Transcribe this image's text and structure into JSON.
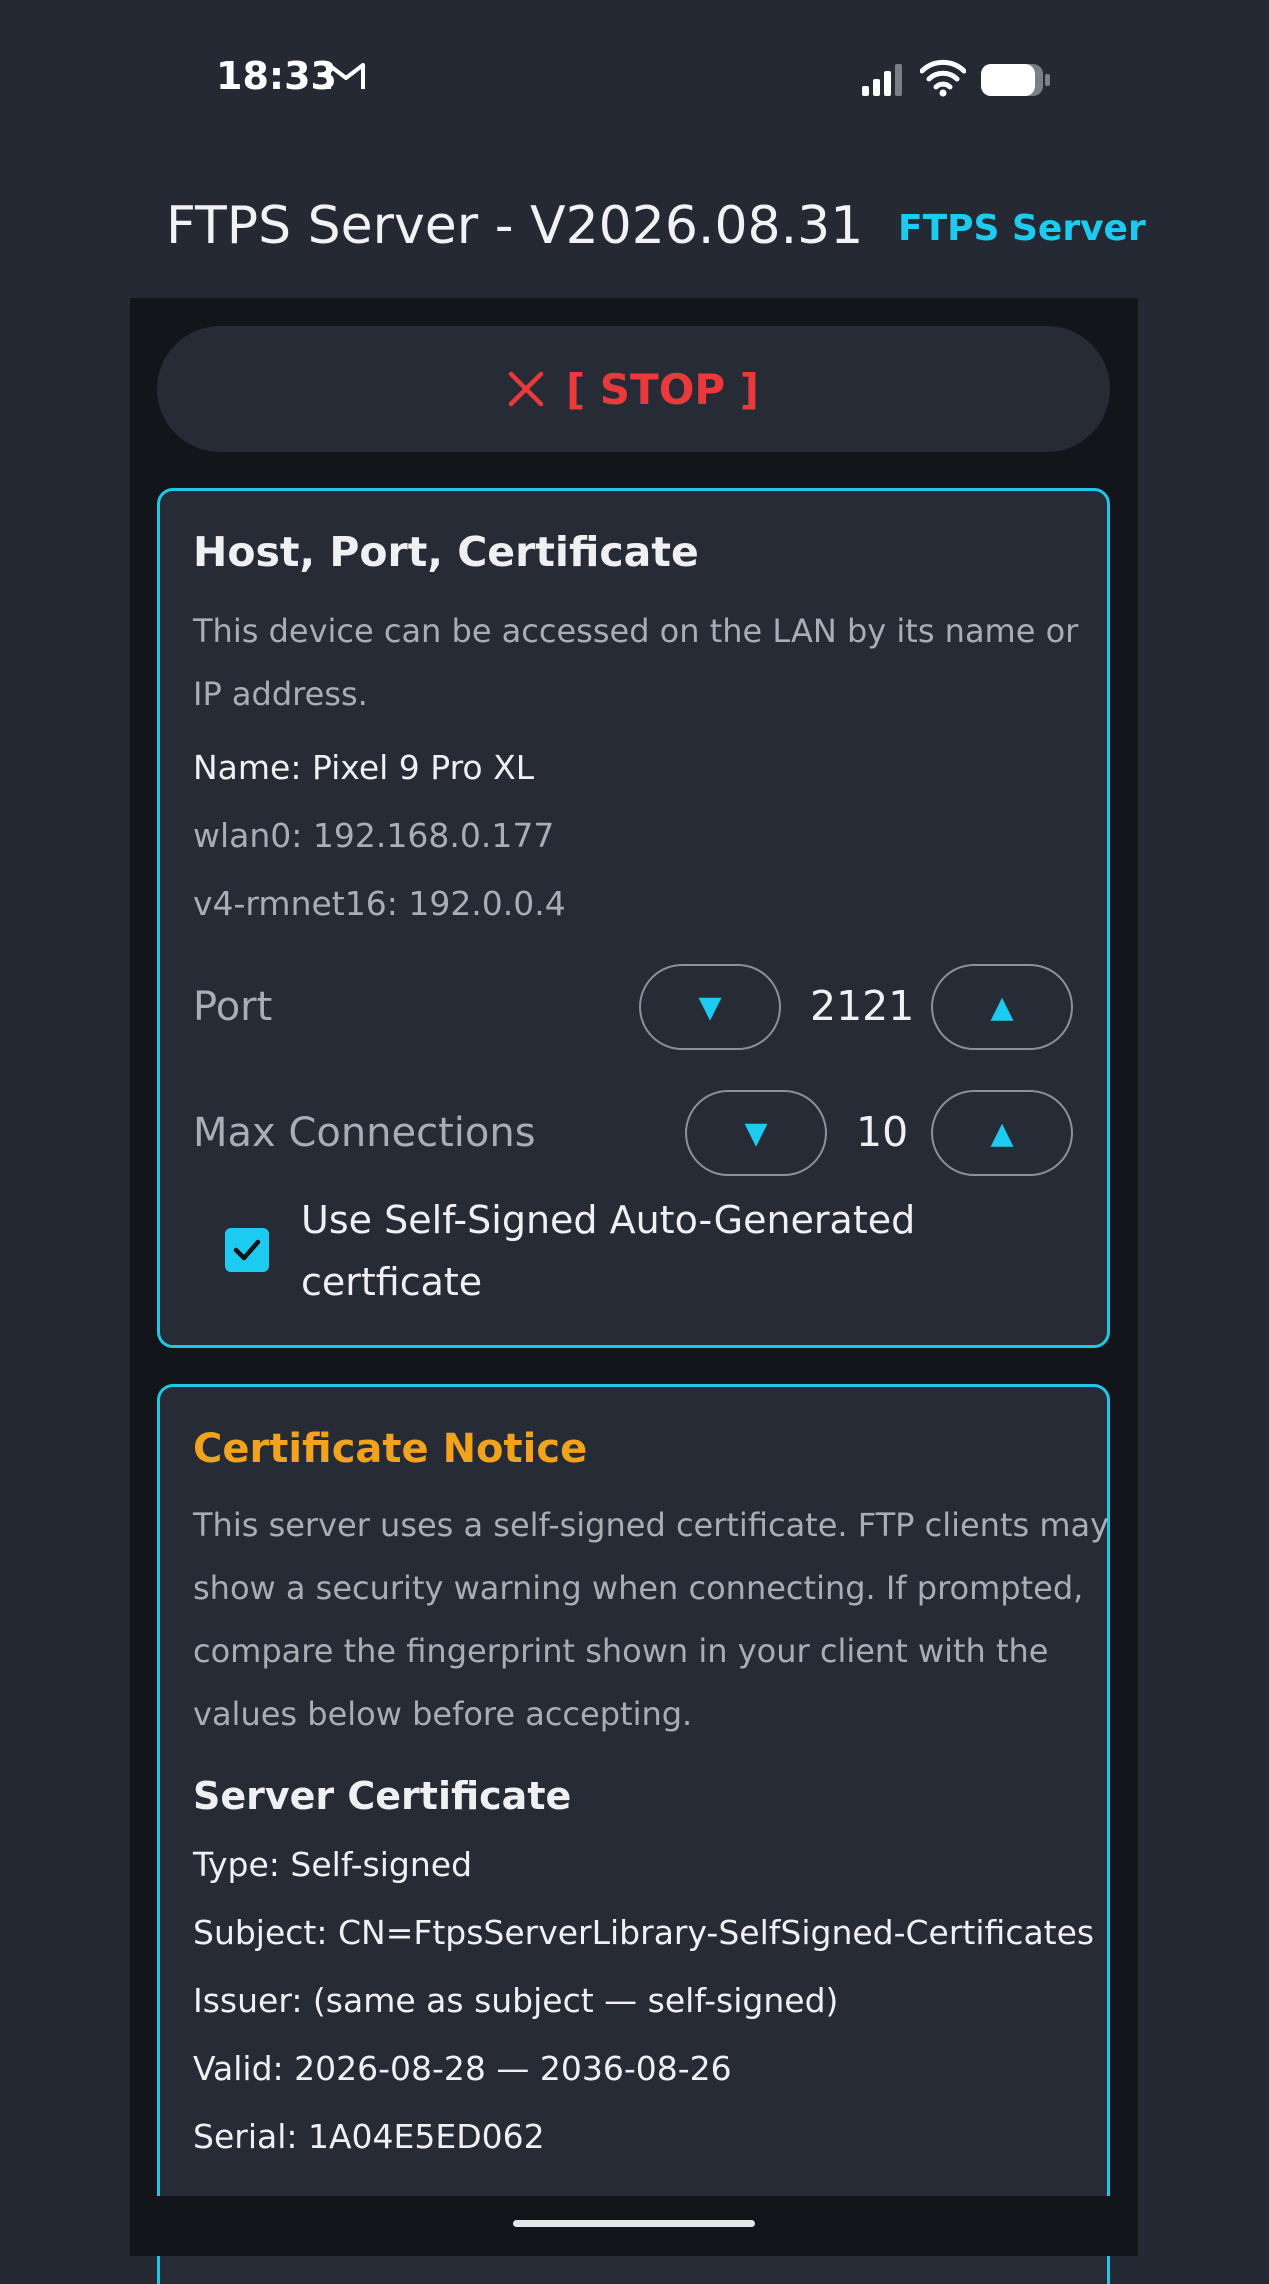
{
  "status_bar": {
    "time": "18:33",
    "icons": [
      "gmail-icon",
      "signal-icon",
      "wifi-icon",
      "battery-icon"
    ]
  },
  "header": {
    "title": "FTPS Server - V2026.08.31",
    "link": "FTPS Server"
  },
  "stop_button": {
    "icon": "close-icon",
    "label": "[ STOP ]"
  },
  "host_card": {
    "title": "Host, Port, Certificate",
    "description_line1": "This device can be accessed on the LAN by its name or",
    "description_line2": "IP address.",
    "name": "Name: Pixel 9 Pro XL",
    "wlan0": "wlan0: 192.168.0.177",
    "rmnet": "v4-rmnet16: 192.0.0.4",
    "port": {
      "label": "Port",
      "value": "2121",
      "decrease_symbol": "▼",
      "increase_symbol": "▲"
    },
    "max_connections": {
      "label": "Max Connections",
      "value": "10",
      "decrease_symbol": "▼",
      "increase_symbol": "▲"
    },
    "self_signed": {
      "checked": true,
      "label_line1": "Use Self-Signed Auto-Generated",
      "label_line2": "certficate"
    }
  },
  "certificate_card": {
    "notice_title": "Certificate Notice",
    "notice_lines": [
      "This server uses a self-signed certificate. FTP clients may",
      "show a security warning when connecting. If prompted,",
      "compare the fingerprint shown in your client with the",
      "values below before accepting."
    ],
    "server_cert_title": "Server Certificate",
    "type": "Type: Self-signed",
    "subject": "Subject: CN=FtpsServerLibrary-SelfSigned-Certificates",
    "issuer": "Issuer: (same as subject — self-signed)",
    "valid": "Valid: 2026-08-28 — 2036-08-26",
    "serial": "Serial: 1A04E5ED062"
  },
  "colors": {
    "background": "#242933",
    "panel": "#121519",
    "accent": "#1ecbf0",
    "stop": "#e9393b",
    "notice": "#f2a31e"
  }
}
